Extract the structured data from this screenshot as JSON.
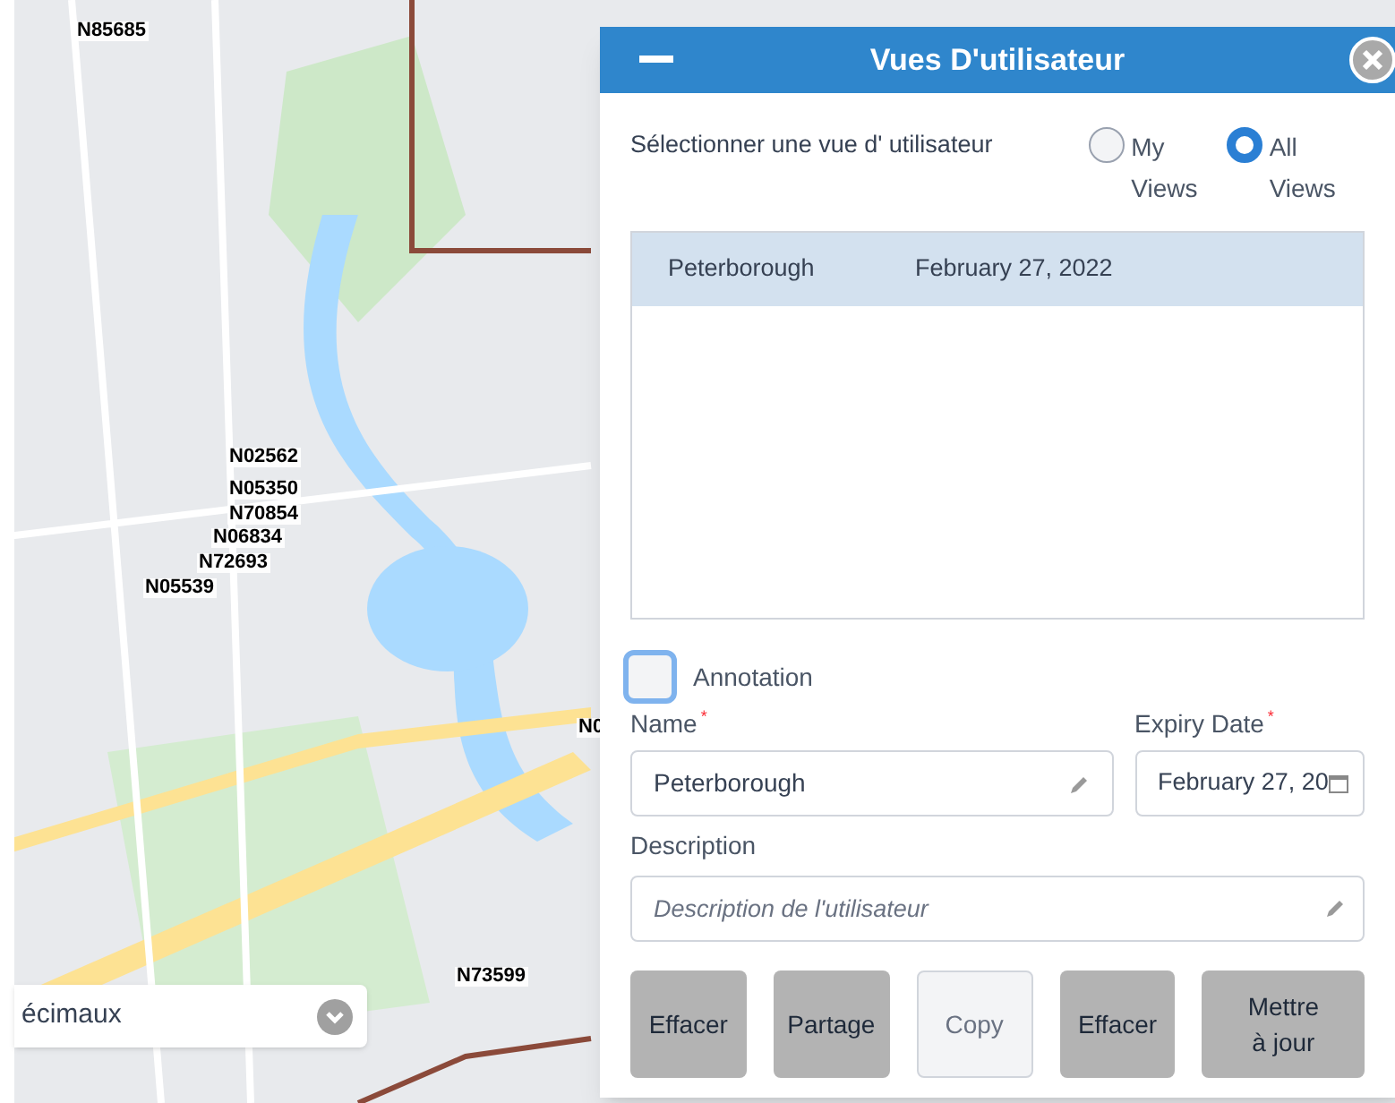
{
  "map_markers": [
    {
      "label": "N85685"
    },
    {
      "label": "N02562"
    },
    {
      "label": "N05350"
    },
    {
      "label": "N70854"
    },
    {
      "label": "N06834"
    },
    {
      "label": "N72693"
    },
    {
      "label": "N05539"
    },
    {
      "label": "N73599"
    },
    {
      "label": "N0"
    }
  ],
  "map_dropdown": {
    "value": "écimaux"
  },
  "dialog": {
    "title": "Vues D'utilisateur",
    "select_label": "Sélectionner une vue d' utilisateur",
    "view_options": [
      {
        "label": "My Views",
        "selected": false
      },
      {
        "label": "All Views",
        "selected": true
      }
    ],
    "views": [
      {
        "name": "Peterborough",
        "date": "February 27, 2022",
        "selected": true
      }
    ],
    "annotation": {
      "label": "Annotation",
      "checked": false
    },
    "name": {
      "label": "Name",
      "required_mark": "*",
      "value": "Peterborough"
    },
    "expiry": {
      "label": "Expiry Date",
      "required_mark": "*",
      "value": "February 27, 20"
    },
    "description": {
      "label": "Description",
      "placeholder": "Description de l'utilisateur"
    },
    "buttons": [
      {
        "label": "Effacer",
        "disabled": false
      },
      {
        "label": "Partage",
        "disabled": false
      },
      {
        "label": "Copy",
        "disabled": true
      },
      {
        "label": "Effacer",
        "disabled": false
      },
      {
        "label": "Mettre à jour",
        "disabled": false
      }
    ]
  }
}
